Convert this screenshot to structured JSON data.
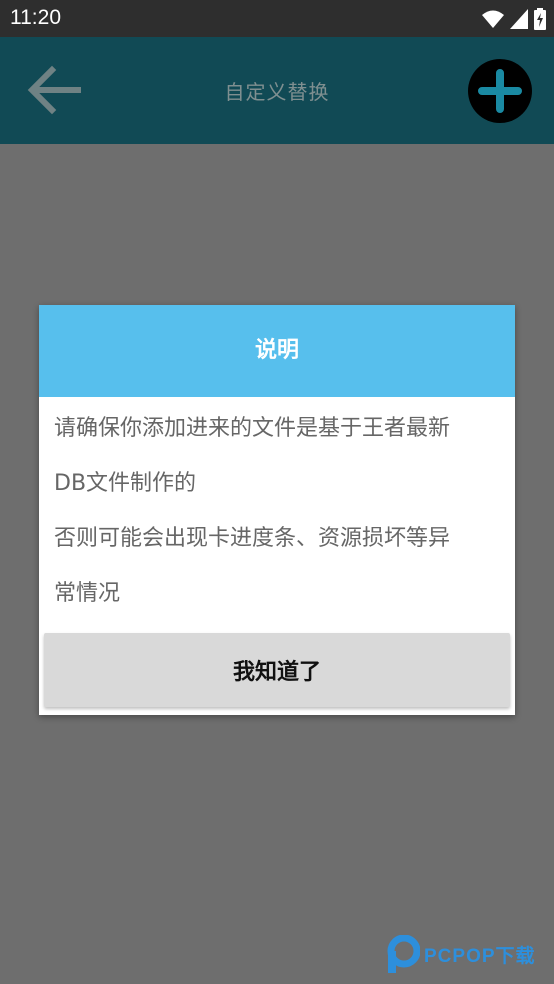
{
  "status_bar": {
    "time": "11:20"
  },
  "app_bar": {
    "title": "自定义替换"
  },
  "dialog": {
    "title": "说明",
    "lines": [
      "请确保你添加进来的文件是基于王者最新",
      "DB文件制作的",
      "否则可能会出现卡进度条、资源损坏等异",
      "常情况"
    ],
    "button": "我知道了"
  },
  "watermark": {
    "text": "PCPOP下载"
  },
  "colors": {
    "app_bar": "#114a55",
    "dialog_header": "#57bfed",
    "overlay": "#6e6e6e",
    "button": "#d9d9d9"
  }
}
